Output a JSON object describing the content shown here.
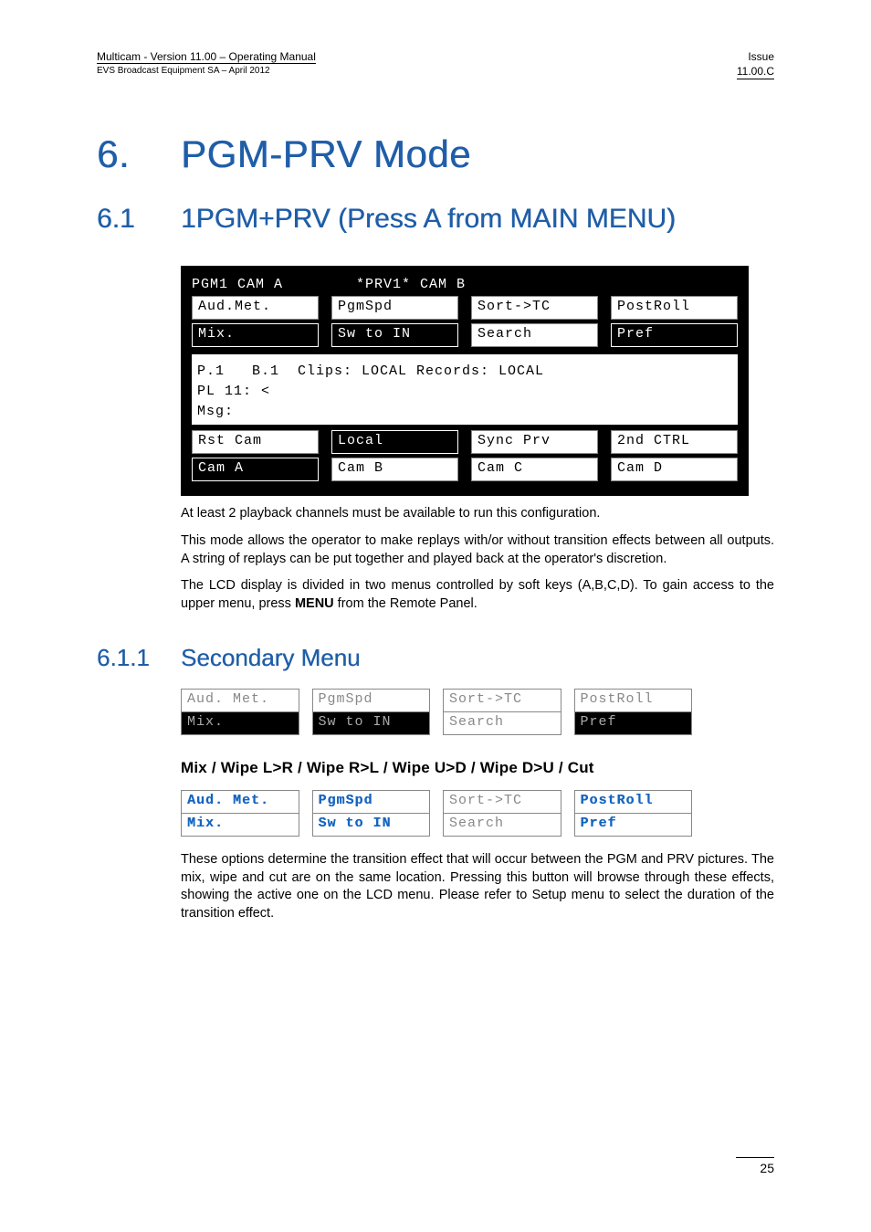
{
  "header": {
    "left_line1": "Multicam - Version 11.00 – Operating Manual",
    "left_line2": "EVS Broadcast Equipment SA – April 2012",
    "right_line1": "Issue",
    "right_line2": "11.00.C"
  },
  "chapter": {
    "num": "6.",
    "title": "PGM-PRV Mode"
  },
  "section": {
    "num": "6.1",
    "title": "1PGM+PRV (Press A from MAIN MENU)"
  },
  "lcd_main": {
    "top_line": "PGM1 CAM A        *PRV1* CAM B",
    "row1": [
      "Aud.Met.",
      "PgmSpd",
      "Sort->TC",
      "PostRoll"
    ],
    "row1_inverse": [
      false,
      false,
      false,
      false
    ],
    "row2": [
      "Mix.",
      "Sw to IN",
      "Search",
      "Pref"
    ],
    "row2_inverse": [
      true,
      true,
      false,
      true
    ],
    "status": "P.1   B.1  Clips: LOCAL Records: LOCAL\nPL 11: <\nMsg:",
    "row3": [
      "Rst Cam",
      "Local",
      "Sync Prv",
      "2nd CTRL"
    ],
    "row3_inverse": [
      false,
      true,
      false,
      false
    ],
    "row4": [
      "Cam A",
      "Cam B",
      "Cam C",
      "Cam D"
    ],
    "row4_inverse": [
      true,
      false,
      false,
      false
    ]
  },
  "paragraphs": {
    "p1": "At least 2 playback channels must be available to run this configuration.",
    "p2": "This mode allows the operator to make replays with/or without transition effects between all outputs. A string of replays can be put together and played back at the operator's discretion.",
    "p3_a": "The LCD display is divided in two menus controlled by soft keys (A,B,C,D). To gain access to the upper menu, press ",
    "p3_bold": "MENU",
    "p3_b": " from the Remote Panel."
  },
  "subsection": {
    "num": "6.1.1",
    "title": "Secondary Menu"
  },
  "mini_panel_1": {
    "row1": [
      "Aud. Met.",
      "PgmSpd",
      "Sort->TC",
      "PostRoll"
    ],
    "row2": [
      "Mix.",
      "Sw to IN",
      "Search",
      "Pref"
    ]
  },
  "sub_h": "Mix / Wipe L>R / Wipe R>L / Wipe U>D / Wipe D>U / Cut",
  "mini_panel_2": {
    "row1": [
      "Aud. Met.",
      "PgmSpd",
      "Sort->TC",
      "PostRoll"
    ],
    "row2": [
      "Mix.",
      "Sw to IN",
      "Search",
      "Pref"
    ]
  },
  "paragraphs2": {
    "p1": "These options determine the transition effect that will occur between the PGM and PRV pictures. The mix, wipe and cut are on the same location. Pressing this button will browse through these effects, showing the active one on the LCD menu.  Please refer to Setup menu to select the duration of the transition effect."
  },
  "page_number": "25"
}
